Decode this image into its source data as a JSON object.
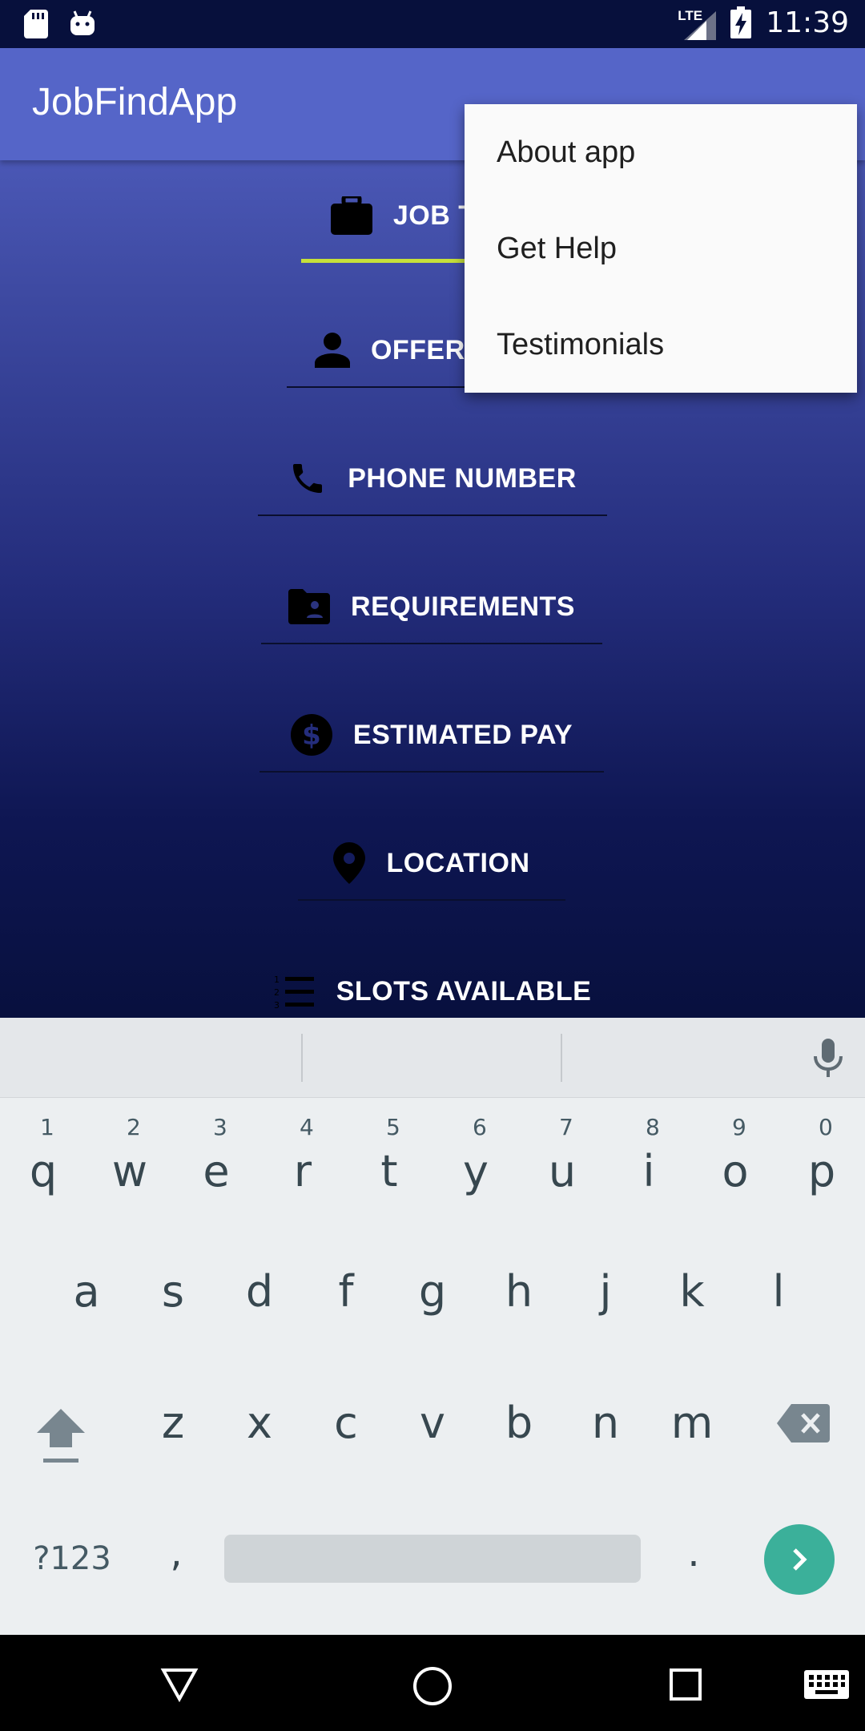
{
  "status_bar": {
    "time": "11:39",
    "network_type": "LTE",
    "icons": [
      "sd-card-icon",
      "android-icon",
      "lte-signal-icon",
      "battery-charging-icon"
    ]
  },
  "toolbar": {
    "title": "JobFindApp"
  },
  "tabs": [
    {
      "icon": "briefcase-icon",
      "label": "JOB TITLE"
    },
    {
      "icon": "person-icon",
      "label": "OFFERED BY"
    },
    {
      "icon": "phone-icon",
      "label": "PHONE NUMBER"
    },
    {
      "icon": "folder-person-icon",
      "label": "REQUIREMENTS"
    },
    {
      "icon": "dollar-circle-icon",
      "label": "ESTIMATED PAY"
    },
    {
      "icon": "location-pin-icon",
      "label": "LOCATION"
    },
    {
      "icon": "numbered-list-icon",
      "label": "SLOTS AVAILABLE"
    }
  ],
  "overflow_menu": {
    "items": [
      "About app",
      "Get Help",
      "Testimonials"
    ]
  },
  "keyboard": {
    "row1": [
      "q",
      "w",
      "e",
      "r",
      "t",
      "y",
      "u",
      "i",
      "o",
      "p"
    ],
    "row1_numbers": [
      "1",
      "2",
      "3",
      "4",
      "5",
      "6",
      "7",
      "8",
      "9",
      "0"
    ],
    "row2": [
      "a",
      "s",
      "d",
      "f",
      "g",
      "h",
      "j",
      "k",
      "l"
    ],
    "row3": [
      "z",
      "x",
      "c",
      "v",
      "b",
      "n",
      "m"
    ],
    "symbols_key": "?123",
    "comma": ",",
    "period": "."
  },
  "colors": {
    "toolbar": "#5565c8",
    "accent_underline": "#c6e03a",
    "enter_key": "#3bb09a"
  }
}
